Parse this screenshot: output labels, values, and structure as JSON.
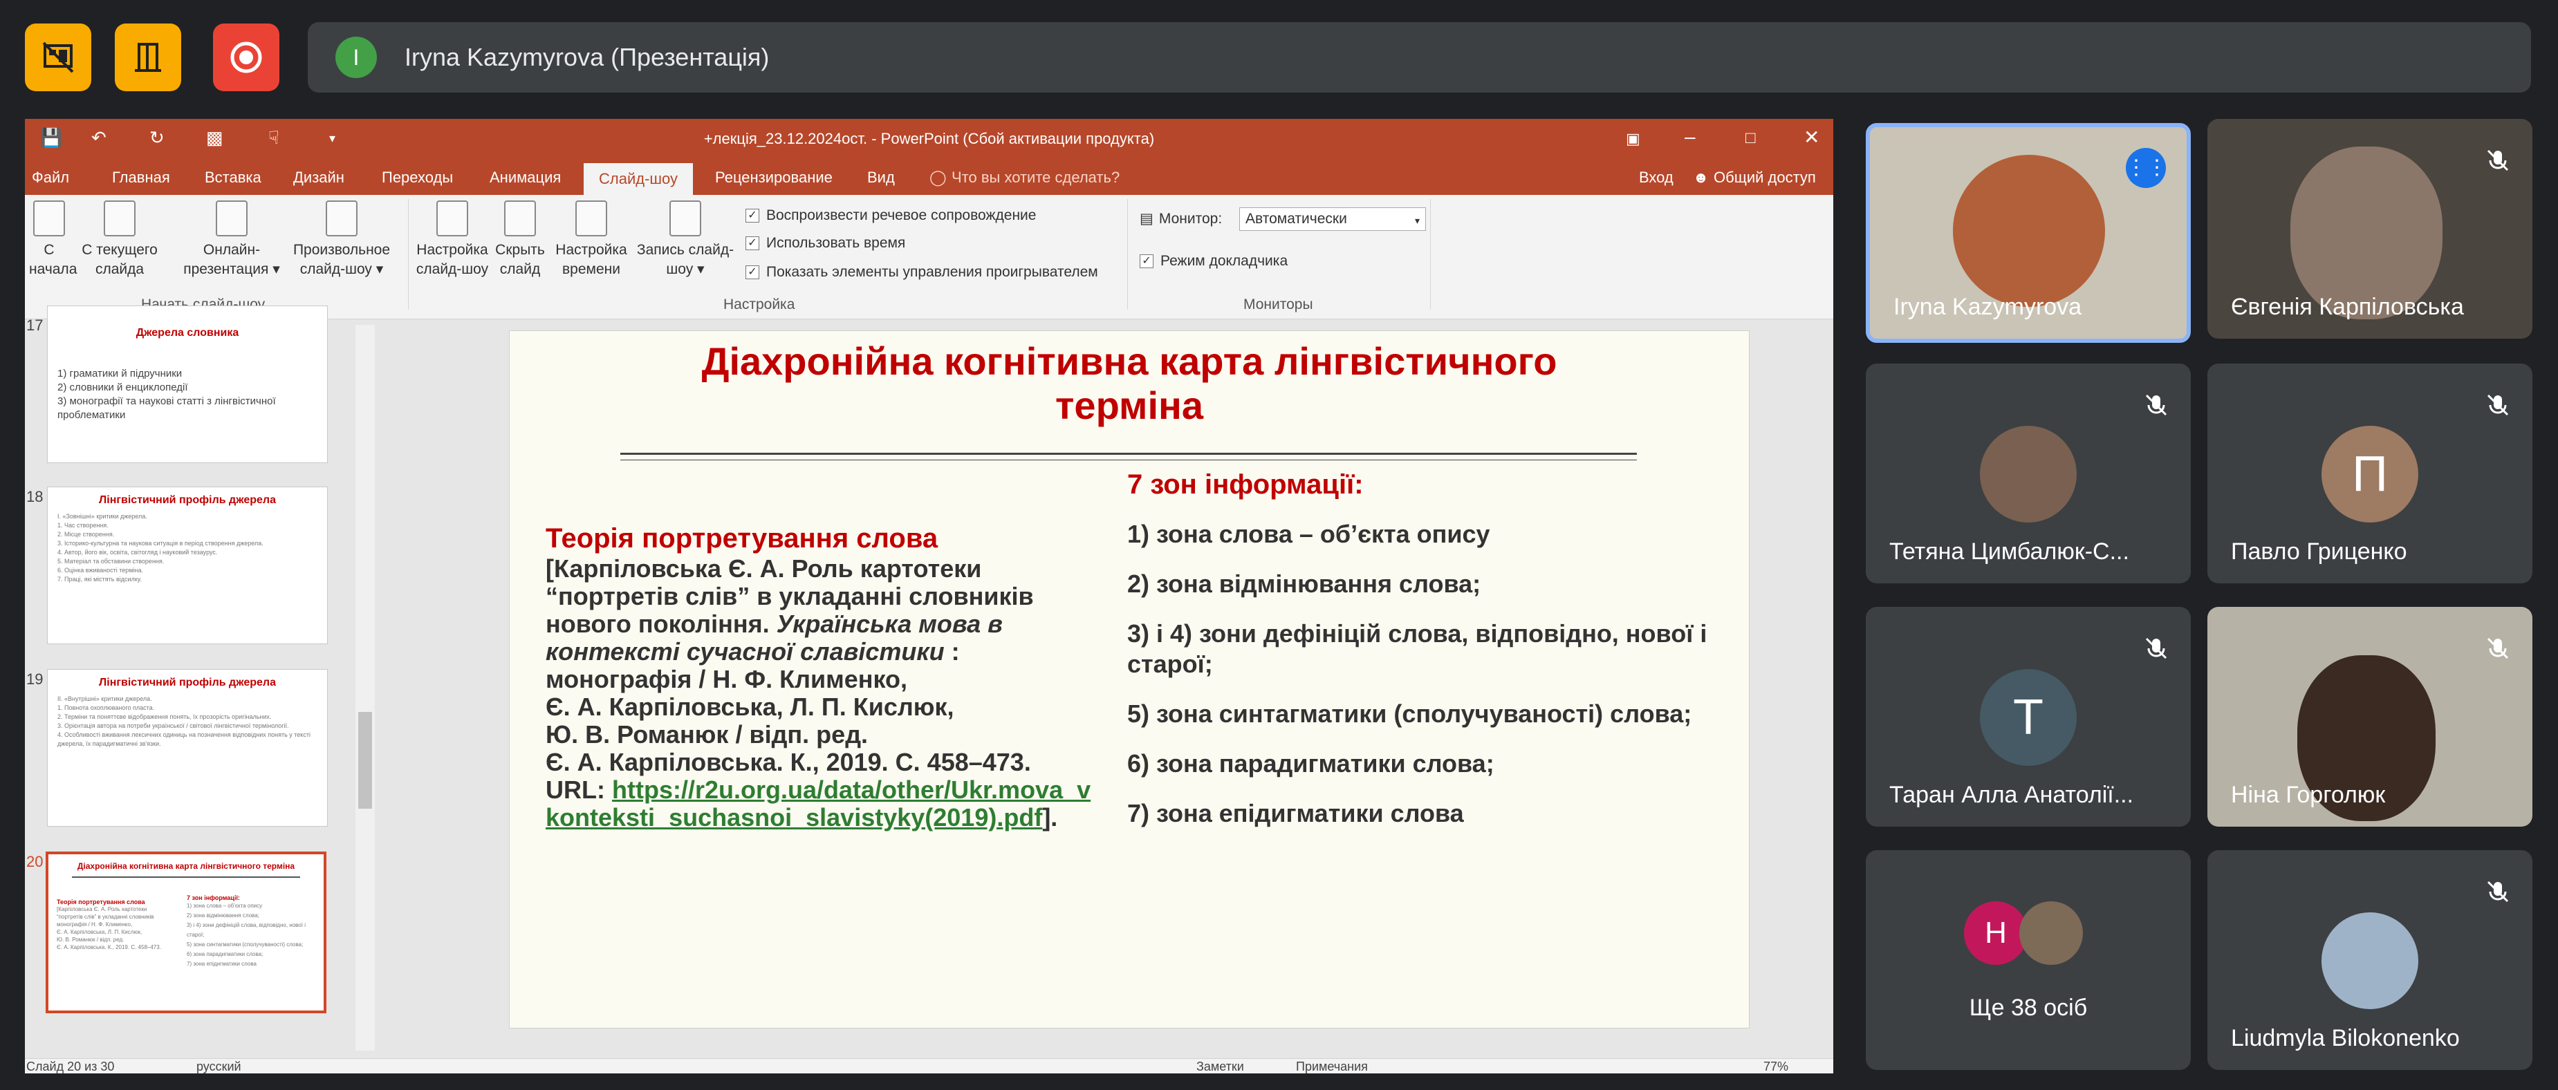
{
  "meet": {
    "presenter_initial": "I",
    "presenter_label": "Iryna Kazymyrova (Презентація)",
    "accent_yellow": "#f9ab00",
    "record_red": "#ea4335"
  },
  "ppt": {
    "window_title": "+лекція_23.12.2024ост. - PowerPoint (Сбой активации продукта)",
    "tabs": [
      "Файл",
      "Главная",
      "Вставка",
      "Дизайн",
      "Переходы",
      "Анимация",
      "Слайд-шоу",
      "Рецензирование",
      "Вид"
    ],
    "tell_me": "Что вы хотите сделать?",
    "sign_in": "Вход",
    "share": "Общий доступ",
    "ribbon": {
      "from_start_1": "С",
      "from_start_2": "начала",
      "from_current_1": "С текущего",
      "from_current_2": "слайда",
      "online_1": "Онлайн-",
      "online_2": "презентация ▾",
      "custom_1": "Произвольное",
      "custom_2": "слайд-шоу ▾",
      "group_start": "Начать слайд-шоу",
      "setup_1": "Настройка",
      "setup_2": "слайд-шоу",
      "hide_1": "Скрыть",
      "hide_2": "слайд",
      "rehearse_1": "Настройка",
      "rehearse_2": "времени",
      "record_1": "Запись слайд-",
      "record_2": "шоу ▾",
      "chk_narration": "Воспроизвести речевое сопровождение",
      "chk_timings": "Использовать время",
      "chk_controls": "Показать элементы управления проигрывателем",
      "group_setup": "Настройка",
      "monitor_label": "Монитор:",
      "monitor_value": "Автоматически",
      "presenter_view": "Режим докладчика",
      "group_monitors": "Мониторы"
    },
    "thumbs": [
      {
        "num": "17",
        "title": "Джерела словника",
        "lines": [
          "1) граматики й підручники",
          "2) словники й енциклопедії",
          "3) монографії та наукові статті з лінгвістичної проблематики"
        ]
      },
      {
        "num": "18",
        "title": "Лінгвістичний профіль джерела",
        "lines": [
          "I. «Зовнішні» критики джерела.",
          "1. Час створення.",
          "2. Місце створення.",
          "3. Історико-культурна та наукова ситуація в період створення джерела.",
          "4. Автор, його вік, освіта, світогляд і науковий тезаурус.",
          "5. Матеріал та обставини створення.",
          "6. Оцінка вживаності терміна.",
          "7. Праці, які містять відсилку."
        ]
      },
      {
        "num": "19",
        "title": "Лінгвістичний профіль джерела",
        "lines": [
          "II. «Внутрішні» критики джерела.",
          "1. Повнота охоплюваного пласта.",
          "2. Терміни та поняттєве відображення понять, їх прозорість оригінальних.",
          "3. Орієнтація автора на потреби української / світової лінгвістичної термінології.",
          "4. Особливості вживання лексичних одиниць на позначення відповідних понять у тексті джерела, їх парадигматичні зв'язки."
        ]
      },
      {
        "num": "20",
        "title": "Діахронійна когнітивна карта лінгвістичного терміна"
      }
    ],
    "slide": {
      "title_1": "Діахронійна когнітивна карта лінгвістичного",
      "title_2": "терміна",
      "left_heading": "Теорія портретування слова",
      "left_1": "[Карпіловська Є. А. Роль картотеки",
      "left_2": "“портретів слів” в укладанні словників",
      "left_3a": "нового покоління. ",
      "left_3b": "Українська мова в",
      "left_4a": "контексті сучасної славістики",
      "left_4b": " :",
      "left_5": "монографія / Н. Ф. Клименко,",
      "left_6": "Є. А. Карпіловська, Л. П. Кислюк,",
      "left_7": "Ю. В. Романюк / відп. ред.",
      "left_8": "Є. А. Карпіловська. К., 2019. С. 458–473.",
      "left_9a": "URL: ",
      "left_9b": "https://r2u.org.ua/data/other/Ukr.mova_v",
      "left_10": "konteksti_suchasnoi_slavistyky(2019).pdf",
      "left_10b": "].",
      "right_heading": "7 зон інформації:",
      "right_items": [
        "1) зона слова – об’єкта опису",
        " 2) зона відмінювання слова;",
        "3) і 4) зони дефініцій слова, відповідно, нової і старої;",
        " 5) зона синтагматики (сполучуваності) слова;",
        " 6) зона парадигматики слова;",
        "7) зона епідигматики слова"
      ]
    },
    "status": {
      "slide_count": "Слайд 20 из 30",
      "language": "русский",
      "notes": "Заметки",
      "comments": "Примечания",
      "zoom": "77%"
    }
  },
  "tiles": [
    {
      "name": "Iryna Kazymyrova",
      "speaking": true
    },
    {
      "name": "Євгенія Карпіловська"
    },
    {
      "name": "Тетяна Цимбалюк-С..."
    },
    {
      "name": "Павло Гриценко",
      "initial": "П"
    },
    {
      "name": "Таран Алла Анатолії...",
      "initial": "Т"
    },
    {
      "name": "Ніна Горголюк"
    },
    {
      "name": "Ще 38 осіб",
      "initial": "Н"
    },
    {
      "name": "Liudmyla Bilokonenko"
    }
  ]
}
